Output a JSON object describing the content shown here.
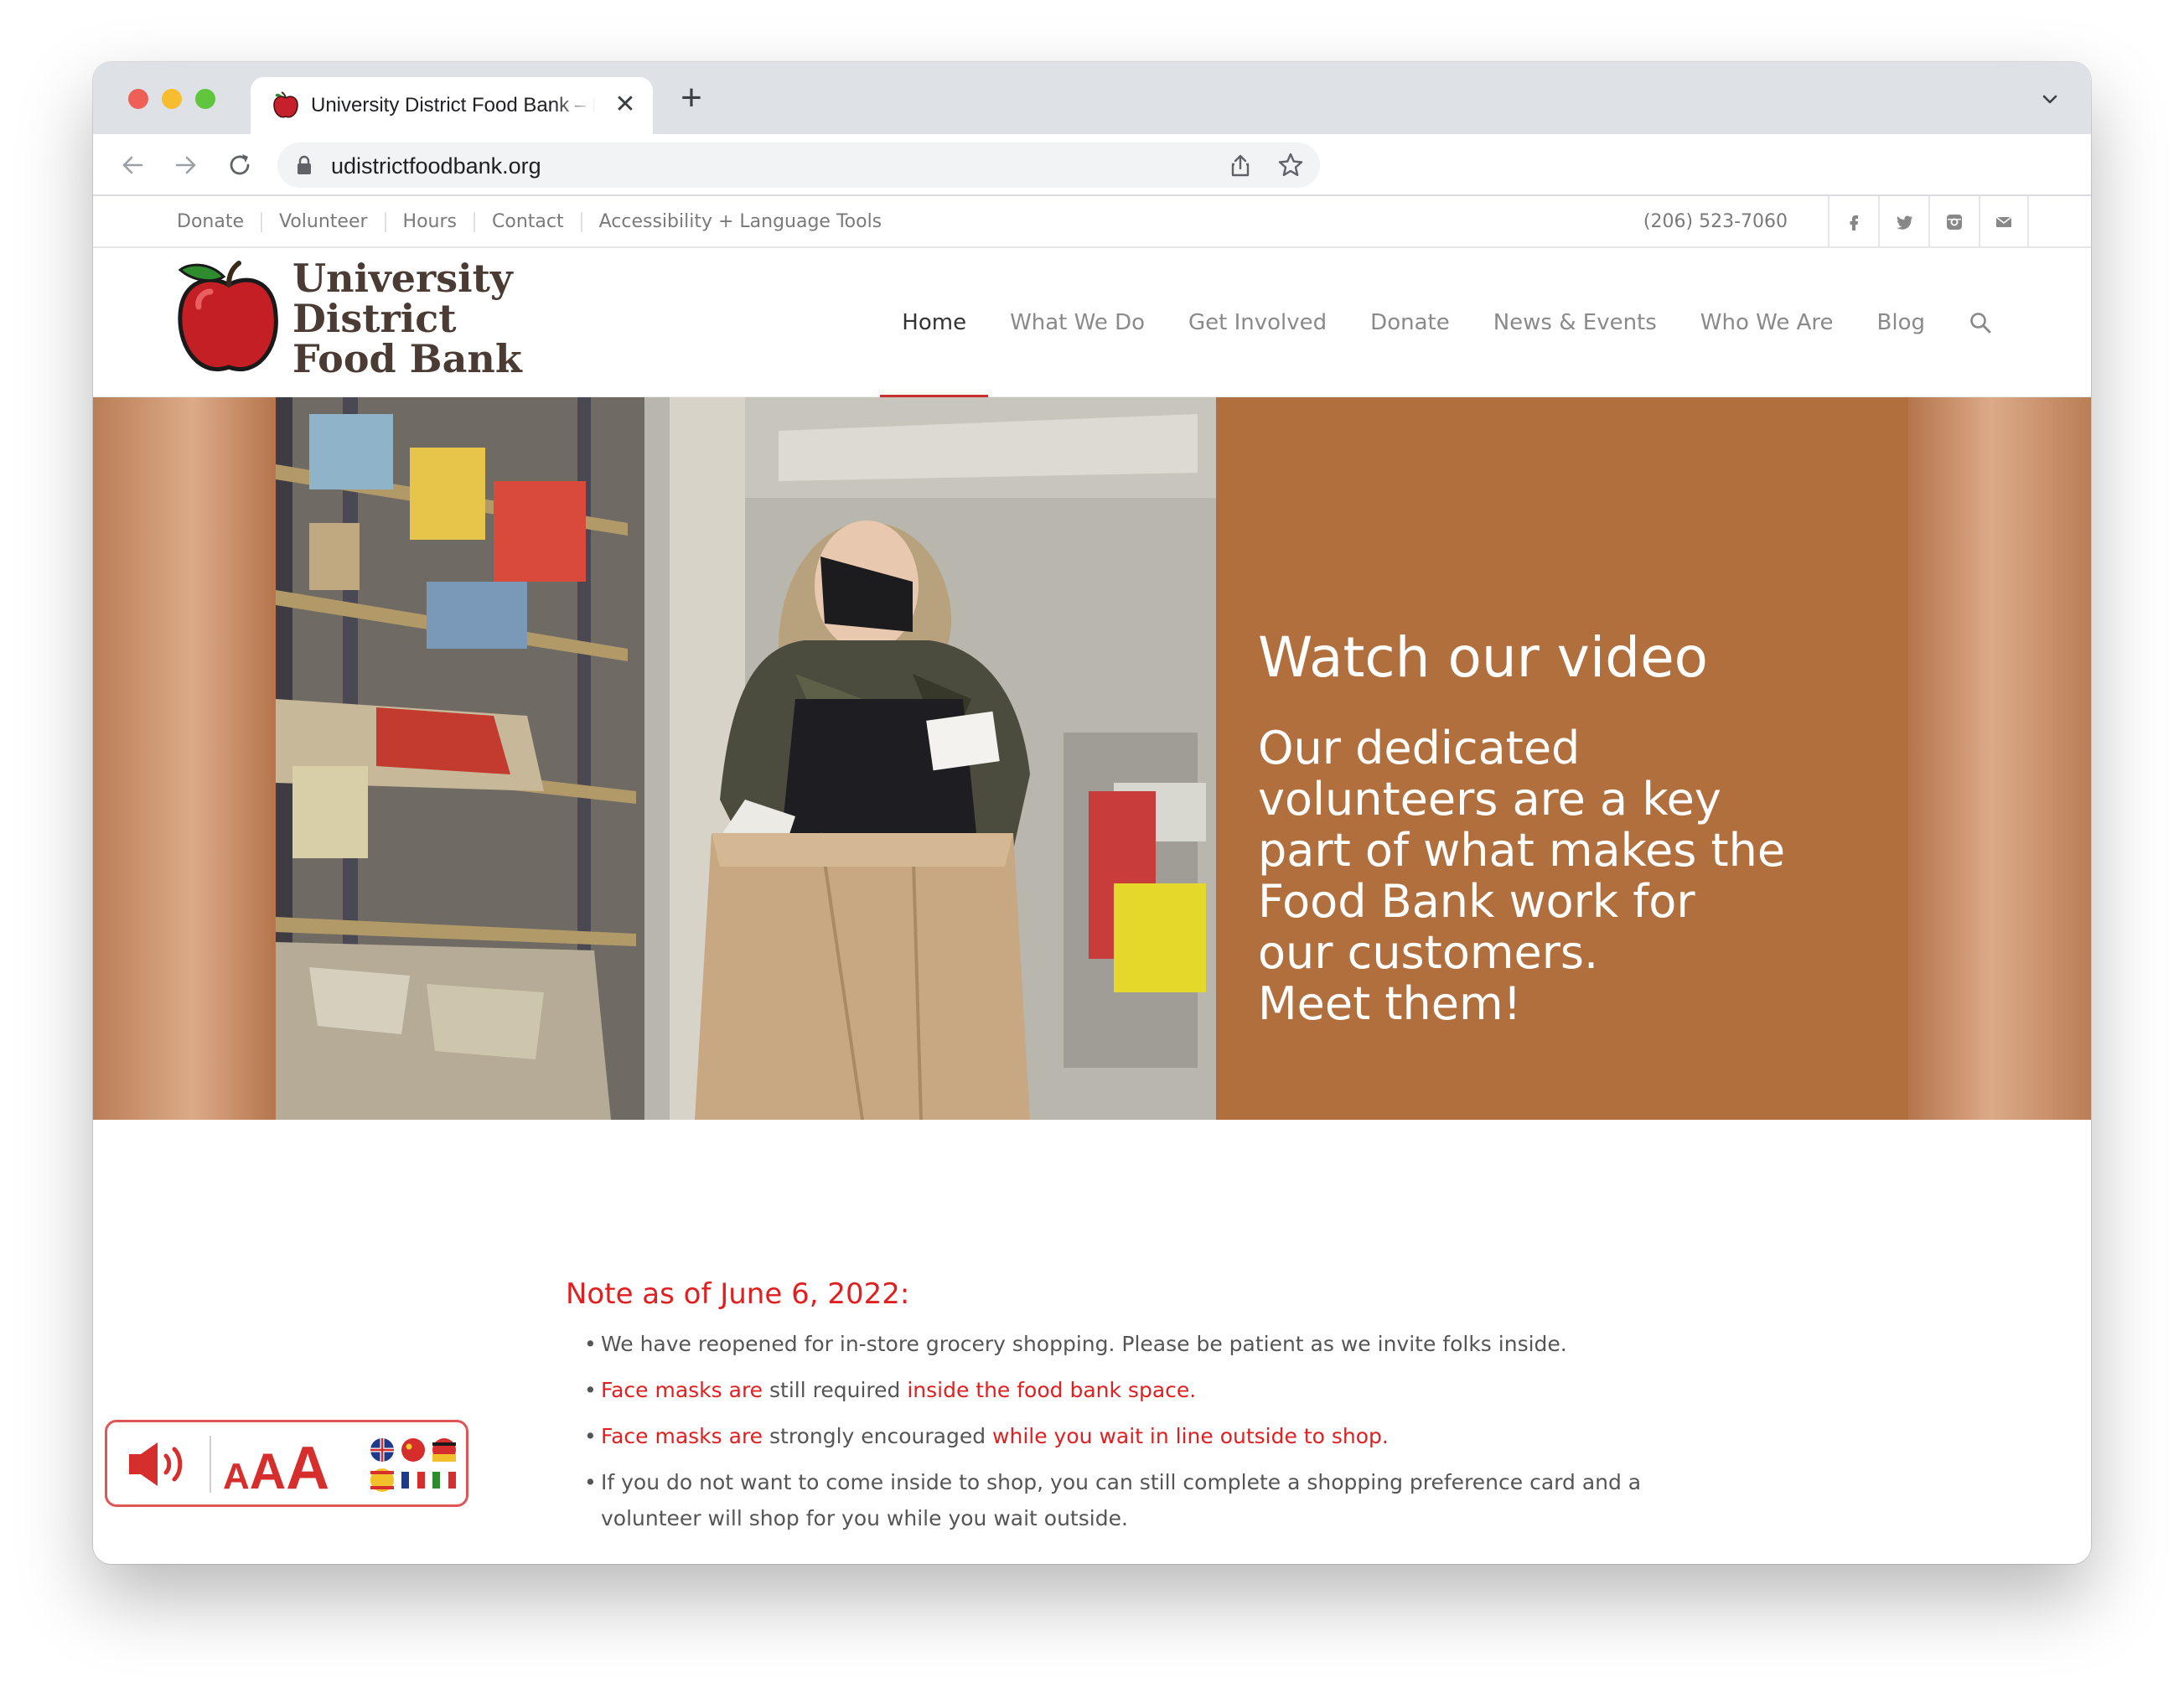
{
  "browser": {
    "tab_title": "University District Food Bank – Fighting hunger",
    "url": "udistrictfoodbank.org"
  },
  "topbar": {
    "links": [
      "Donate",
      "Volunteer",
      "Hours",
      "Contact",
      "Accessibility + Language Tools"
    ],
    "phone": "(206) 523-7060"
  },
  "logo": {
    "line1": "University",
    "line2": "District",
    "line3": "Food Bank"
  },
  "nav": {
    "items": [
      "Home",
      "What We Do",
      "Get Involved",
      "Donate",
      "News & Events",
      "Who We Are",
      "Blog"
    ],
    "active": "Home"
  },
  "hero": {
    "title": "Watch our video",
    "line1": "Our dedicated",
    "line2": "volunteers are a key",
    "line3": "part of what makes the",
    "line4": "Food Bank work for",
    "line5": "our customers.",
    "line6": "Meet them!"
  },
  "notice": {
    "title": "Note as of June 6, 2022:",
    "item1": "We have reopened for in-store grocery shopping. Please be patient as we invite folks inside.",
    "item2_a": "Face masks are",
    "item2_b": " still required ",
    "item2_c": "inside the food bank space.",
    "item3_a": "Face masks are",
    "item3_b": " strongly encouraged ",
    "item3_c": "while you wait in line outside to shop.",
    "item4": "If you do not want to come inside to shop, you can still complete a shopping preference card and a volunteer will shop for you while you wait outside."
  },
  "a11y_widget": {
    "text_a1": "A",
    "text_a2": "A",
    "text_a3": "A"
  },
  "colors": {
    "accent_red": "#e02020",
    "hero_panel": "#b16f3e",
    "logo_text": "#4a3c34"
  }
}
